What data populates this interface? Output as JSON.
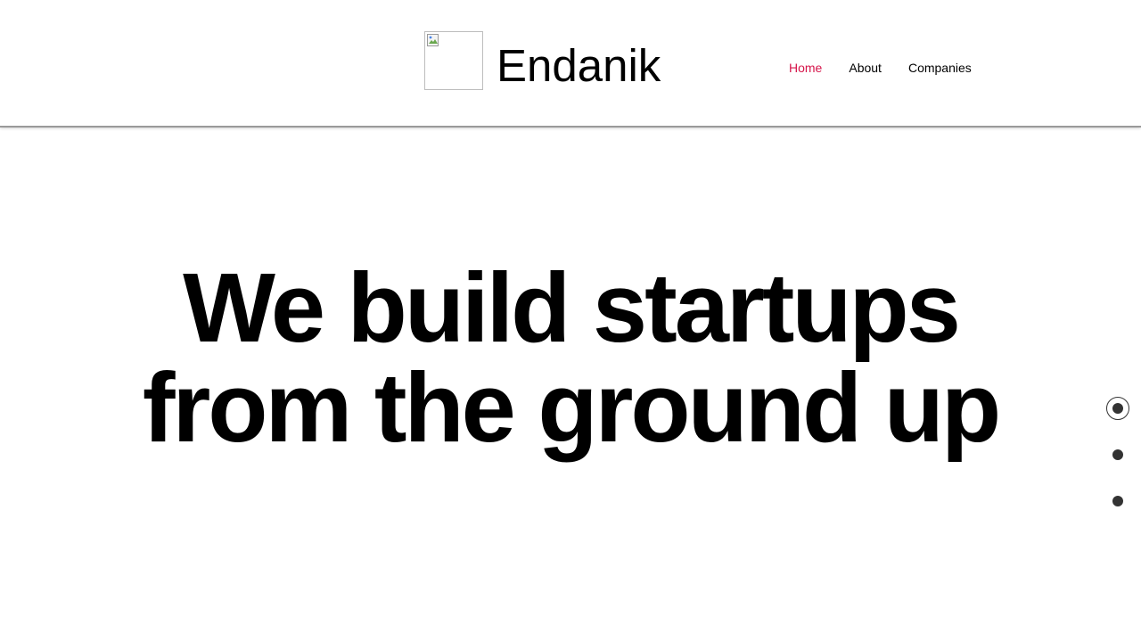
{
  "header": {
    "brand_name": "Endanik",
    "logo_icon": "broken-image-icon",
    "nav": [
      {
        "label": "Home",
        "active": true
      },
      {
        "label": "About",
        "active": false
      },
      {
        "label": "Companies",
        "active": false
      }
    ],
    "active_color": "#d6164b"
  },
  "hero": {
    "line1": "We build startups",
    "line2": "from the ground up"
  },
  "section_nav": {
    "count": 3,
    "active_index": 0
  }
}
